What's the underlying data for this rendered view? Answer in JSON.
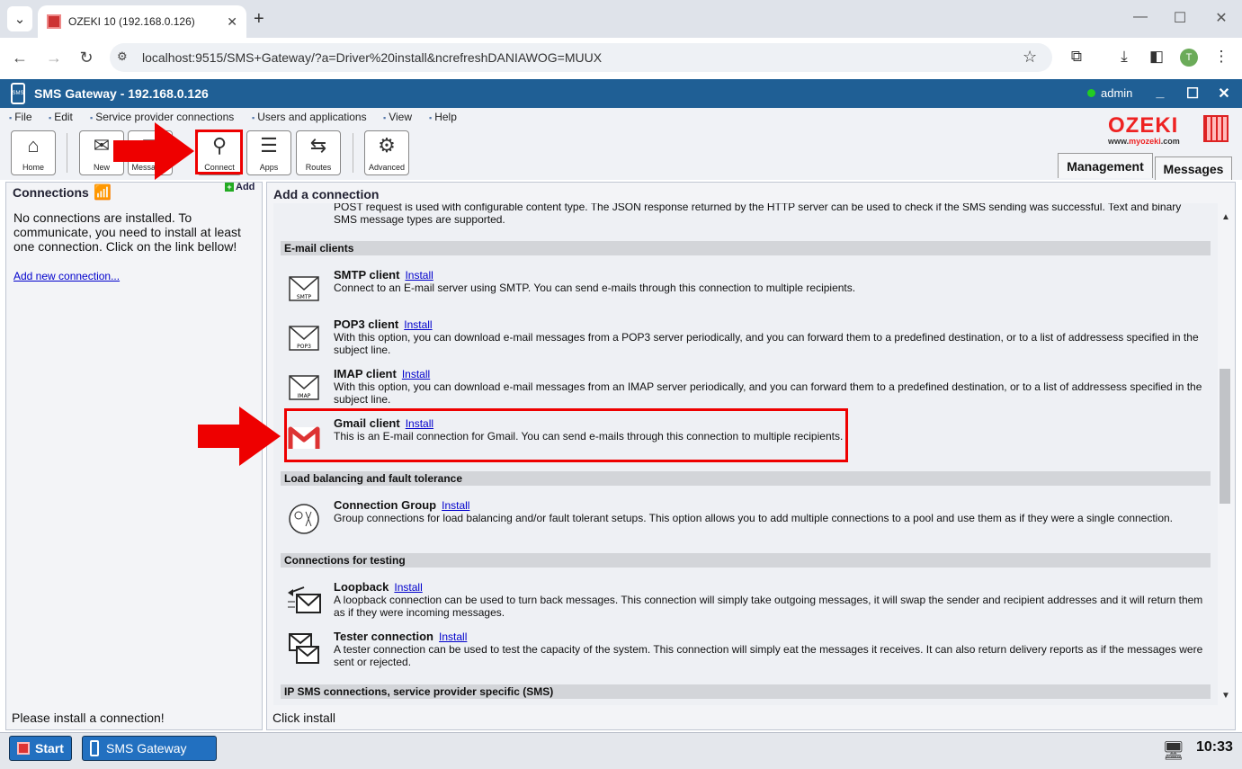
{
  "browser": {
    "tab_title": "OZEKI 10 (192.168.0.126)",
    "url": "localhost:9515/SMS+Gateway/?a=Driver%20install&ncrefreshDANIAWOG=MUUX",
    "avatar_letter": "T"
  },
  "app": {
    "title": "SMS Gateway - 192.168.0.126",
    "user": "admin",
    "menu": [
      "File",
      "Edit",
      "Service provider connections",
      "Users and applications",
      "View",
      "Help"
    ],
    "logo_text": "OZEKI",
    "logo_sub_prefix": "www.",
    "logo_sub_brand": "myozeki",
    "logo_sub_suffix": ".com",
    "toolbar": {
      "home": "Home",
      "new": "New",
      "messages": "Messages",
      "connect": "Connect",
      "apps": "Apps",
      "routes": "Routes",
      "advanced": "Advanced"
    },
    "tabs": {
      "management": "Management",
      "messages": "Messages"
    }
  },
  "left_panel": {
    "title": "Connections",
    "add": "Add",
    "message": "No connections are installed. To communicate, you need to install at least one connection. Click on the link bellow!",
    "link": "Add new connection...",
    "status": "Please install a connection!"
  },
  "right_panel": {
    "title": "Add a connection",
    "status": "Click install",
    "top_cut_text_1": "POST request is used with configurable content type. The JSON response returned by the HTTP server can be used to check if the SMS sending was successful. Text and binary",
    "top_cut_text_2": "SMS message types are supported.",
    "install_label": "Install",
    "sections": {
      "email": "E-mail clients",
      "lb": "Load balancing and fault tolerance",
      "testing": "Connections for testing",
      "ip": "IP SMS connections, service provider specific (SMS)"
    },
    "items": {
      "smtp": {
        "name": "SMTP client",
        "desc": "Connect to an E-mail server using SMTP. You can send e-mails through this connection to multiple recipients."
      },
      "pop3": {
        "name": "POP3 client",
        "desc": "With this option, you can download e-mail messages from a POP3 server periodically, and you can forward them to a predefined destination, or to a list of addressess specified in the subject line."
      },
      "imap": {
        "name": "IMAP client",
        "desc": "With this option, you can download e-mail messages from an IMAP server periodically, and you can forward them to a predefined destination, or to a list of addressess specified in the subject line."
      },
      "gmail": {
        "name": "Gmail client",
        "desc": "This is an E-mail connection for Gmail. You can send e-mails through this connection to multiple recipients."
      },
      "group": {
        "name": "Connection Group",
        "desc": "Group connections for load balancing and/or fault tolerant setups. This option allows you to add multiple connections to a pool and use them as if they were a single connection."
      },
      "loopback": {
        "name": "Loopback",
        "desc": "A loopback connection can be used to turn back messages. This connection will simply take outgoing messages, it will swap the sender and recipient addresses and it will return them as if they were incoming messages."
      },
      "tester": {
        "name": "Tester connection",
        "desc": "A tester connection can be used to test the capacity of the system. This connection will simply eat the messages it receives. It can also return delivery reports as if the messages were sent or rejected."
      }
    },
    "icon_labels": {
      "smtp": "SMTP",
      "pop3": "POP3",
      "imap": "IMAP"
    }
  },
  "taskbar": {
    "start": "Start",
    "app": "SMS Gateway",
    "clock": "10:33"
  },
  "colors": {
    "title_bar": "#1f5f95",
    "highlight": "#e00",
    "link": "#00c",
    "logo": "#e22"
  }
}
